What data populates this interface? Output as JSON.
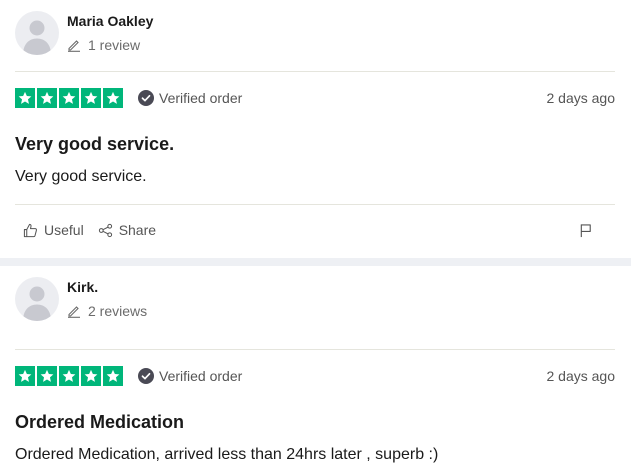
{
  "colors": {
    "star_green": "#00b67a",
    "page_gray": "#eef0f4",
    "text_dark": "#1a1a1a",
    "text_muted": "#555555"
  },
  "reviews": [
    {
      "user_name": "Maria Oakley",
      "review_count": "1 review",
      "rating": 5,
      "verified_label": "Verified order",
      "date": "2 days ago",
      "title": "Very good service.",
      "body": "Very good service.",
      "useful_label": "Useful",
      "share_label": "Share"
    },
    {
      "user_name": "Kirk.",
      "review_count": "2 reviews",
      "rating": 5,
      "verified_label": "Verified order",
      "date": "2 days ago",
      "title": "Ordered Medication",
      "body": "Ordered Medication, arrived less than 24hrs later , superb :)"
    }
  ],
  "icons": [
    "avatar-placeholder-icon",
    "pencil-icon",
    "star-icon",
    "check-circle-icon",
    "thumbs-up-icon",
    "share-icon",
    "flag-icon"
  ]
}
